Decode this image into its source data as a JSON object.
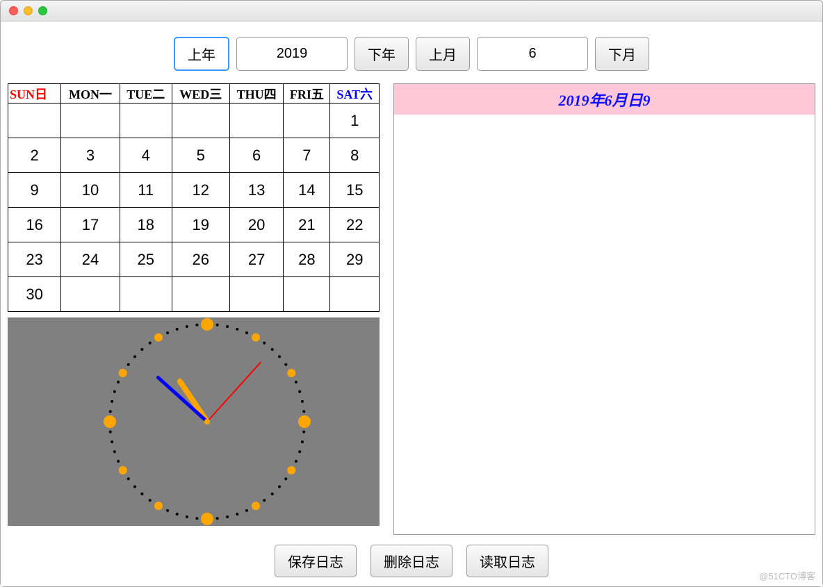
{
  "toolbar": {
    "prev_year": "上年",
    "year_value": "2019",
    "next_year": "下年",
    "prev_month": "上月",
    "month_value": "6",
    "next_month": "下月"
  },
  "calendar": {
    "headers": [
      "SUN日",
      "MON一",
      "TUE二",
      "WED三",
      "THU四",
      "FRI五",
      "SAT六"
    ],
    "weeks": [
      [
        "",
        "",
        "",
        "",
        "",
        "",
        "1"
      ],
      [
        "2",
        "3",
        "4",
        "5",
        "6",
        "7",
        "8"
      ],
      [
        "9",
        "10",
        "11",
        "12",
        "13",
        "14",
        "15"
      ],
      [
        "16",
        "17",
        "18",
        "19",
        "20",
        "21",
        "22"
      ],
      [
        "23",
        "24",
        "25",
        "26",
        "27",
        "28",
        "29"
      ],
      [
        "30",
        "",
        "",
        "",
        "",
        "",
        ""
      ]
    ]
  },
  "diary": {
    "header": "2019年6月日9"
  },
  "clock": {
    "hour": 10,
    "minute": 52,
    "second": 7
  },
  "buttons": {
    "save": "保存日志",
    "delete": "删除日志",
    "read": "读取日志"
  },
  "watermark": "@51CTO博客"
}
